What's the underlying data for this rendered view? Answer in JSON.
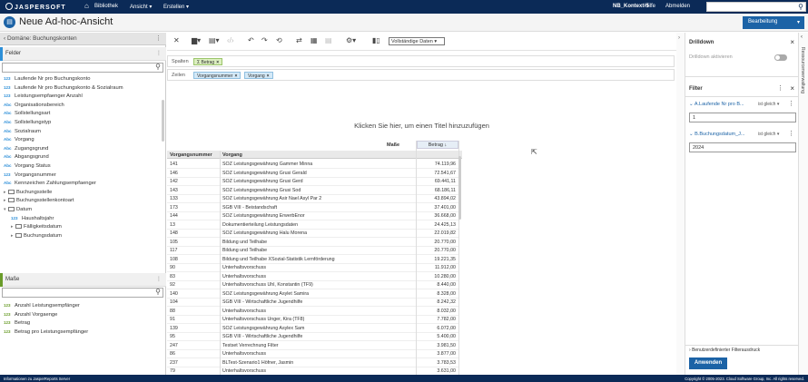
{
  "topbar": {
    "logo": "JASPERSOFT",
    "nav": [
      "Bibliothek",
      "Ansicht",
      "Erstellen"
    ],
    "context": "NB_Kontext-5",
    "help": "Hilfe",
    "logout": "Abmelden"
  },
  "titlebar": {
    "title": "Neue Ad-hoc-Ansicht",
    "edit_button": "Bearbeitung"
  },
  "left": {
    "domain": "Domäne: Buchungskonten",
    "fields_header": "Felder",
    "fields": [
      {
        "type": "123",
        "label": "Laufende Nr pro Buchungskonto",
        "indent": 0
      },
      {
        "type": "123",
        "label": "Laufende Nr pro Buchungskonto & Sozialraum",
        "indent": 0
      },
      {
        "type": "123",
        "label": "Leistungsempfaenger Anzahl",
        "indent": 0
      },
      {
        "type": "Abc",
        "label": "Organisationsbereich",
        "indent": 0
      },
      {
        "type": "Abc",
        "label": "Sollstellungsart",
        "indent": 0
      },
      {
        "type": "Abc",
        "label": "Sollstellungstyp",
        "indent": 0
      },
      {
        "type": "Abc",
        "label": "Sozialraum",
        "indent": 0
      },
      {
        "type": "Abc",
        "label": "Vorgang",
        "indent": 0
      },
      {
        "type": "Abc",
        "label": "Zugangsgrund",
        "indent": 0
      },
      {
        "type": "Abc",
        "label": "Abgangsgrund",
        "indent": 0
      },
      {
        "type": "Abc",
        "label": "Vorgang Status",
        "indent": 0
      },
      {
        "type": "123",
        "label": "Vorgangsnummer",
        "indent": 0
      },
      {
        "type": "Abc",
        "label": "Kennzeichen Zahlungsempfaenger",
        "indent": 0
      },
      {
        "type": "folder",
        "label": "Buchungsstelle",
        "indent": 0
      },
      {
        "type": "folder",
        "label": "Buchungsstellenkontoart",
        "indent": 0
      },
      {
        "type": "folder-open",
        "label": "Datum",
        "indent": 0
      },
      {
        "type": "123",
        "label": "Haushaltsjahr",
        "indent": 1
      },
      {
        "type": "folder",
        "label": "Fälligkeitsdatum",
        "indent": 1
      },
      {
        "type": "folder",
        "label": "Buchungsdatum",
        "indent": 1
      }
    ],
    "measures_header": "Maße",
    "measures": [
      {
        "type": "123",
        "label": "Anzahl Leistungsempfänger"
      },
      {
        "type": "123",
        "label": "Anzahl Vorgaenge"
      },
      {
        "type": "123",
        "label": "Betrag"
      },
      {
        "type": "123",
        "label": "Betrag pro Leistungsempfänger"
      }
    ]
  },
  "toolbar": {
    "view_select": "Vollständige Daten"
  },
  "shelves": {
    "columns_label": "Spalten",
    "columns_pills": [
      "Σ Betrag"
    ],
    "rows_label": "Zeilen",
    "rows_pills": [
      "Vorgangsnummer",
      "Vorgang"
    ]
  },
  "hint": "Klicken Sie hier, um einen Titel hinzuzufügen",
  "grid": {
    "measures_label": "Maße",
    "measure_col": "Betrag ↓",
    "col1": "Vorgangsnummer",
    "col2": "Vorgang",
    "rows": [
      [
        "141",
        "SOZ Leistungsgewährung Gammer Minna",
        "74.119,96"
      ],
      [
        "146",
        "SOZ Leistungsgewährung Grusi Gerald",
        "72.541,67"
      ],
      [
        "142",
        "SOZ Leistungsgewährung Grusi Gerd",
        "69.441,11"
      ],
      [
        "143",
        "SOZ Leistungsgewährung Grusi Sod",
        "68.186,11"
      ],
      [
        "133",
        "SOZ Leistungsgewährung Asir Nael Asyl Par 2",
        "43.894,02"
      ],
      [
        "173",
        "SGB VIII - Beistandschaft",
        "37.401,00"
      ],
      [
        "144",
        "SOZ Leistungsgewährung ErwerbEnor",
        "36.668,00"
      ],
      [
        "13",
        "Dokumentierteilung Leistungsdaten",
        "24.425,13"
      ],
      [
        "148",
        "SOZ Leistungsgewährung Halu Morena",
        "22.019,82"
      ],
      [
        "105",
        "Bildung und Teilhabe",
        "20.770,00"
      ],
      [
        "117",
        "Bildung und Teilhabe",
        "20.770,00"
      ],
      [
        "108",
        "Bildung und Teilhabe XSozial-Statistik Lernförderung",
        "19.221,35"
      ],
      [
        "90",
        "Unterhaltsvorschuss",
        "11.912,00"
      ],
      [
        "83",
        "Unterhaltsvorschuss",
        "10.280,00"
      ],
      [
        "92",
        "Unterhaltsvorschuss Uhl, Konstantin (TF9)",
        "8.440,00"
      ],
      [
        "140",
        "SOZ Leistungsgewährung Asylet Samira",
        "8.328,00"
      ],
      [
        "104",
        "SGB VIII - Wirtschaftliche Jugendhilfe",
        "8.242,32"
      ],
      [
        "88",
        "Unterhaltsvorschuss",
        "8.032,00"
      ],
      [
        "91",
        "Unterhaltsvorschuss Unger, Kira (TF8)",
        "7.782,00"
      ],
      [
        "139",
        "SOZ Leistungsgewährung Asylex Sam",
        "6.072,00"
      ],
      [
        "95",
        "SGB VIII - Wirtschaftliche Jugendhilfe",
        "5.400,00"
      ],
      [
        "247",
        "Testset Verrechnung Filter",
        "3.981,50"
      ],
      [
        "86",
        "Unterhaltsvorschuss",
        "3.877,00"
      ],
      [
        "237",
        "BLTest-Szenario1 Höfner, Jasmin",
        "3.783,53"
      ],
      [
        "79",
        "Unterhaltsvorschuss",
        "3.631,00"
      ]
    ]
  },
  "right": {
    "drilldown_title": "Drilldown",
    "drilldown_toggle": "Drilldown aktivieren",
    "filter_title": "Filter",
    "filters": [
      {
        "name": "A.Laufende Nr pro B...",
        "op": "ist gleich",
        "value": "1"
      },
      {
        "name": "B.Buchungsdatum_J...",
        "op": "ist gleich",
        "value": "2024"
      }
    ],
    "custom_filter": "Benutzerdefinierter Filterausdruck",
    "apply": "Anwenden",
    "vertical_tab": "Ressourcenverwaltung"
  },
  "footer": {
    "left": "Informationen zu JasperReports Server",
    "right": "Copyright © 2005-2023. Cloud Software Group, Inc. All rights reserved."
  },
  "colors": {
    "navy": "#0b2a57",
    "accent": "#1c63a6",
    "pill_green": "#dcefc0",
    "pill_blue": "#d4e9f7"
  }
}
